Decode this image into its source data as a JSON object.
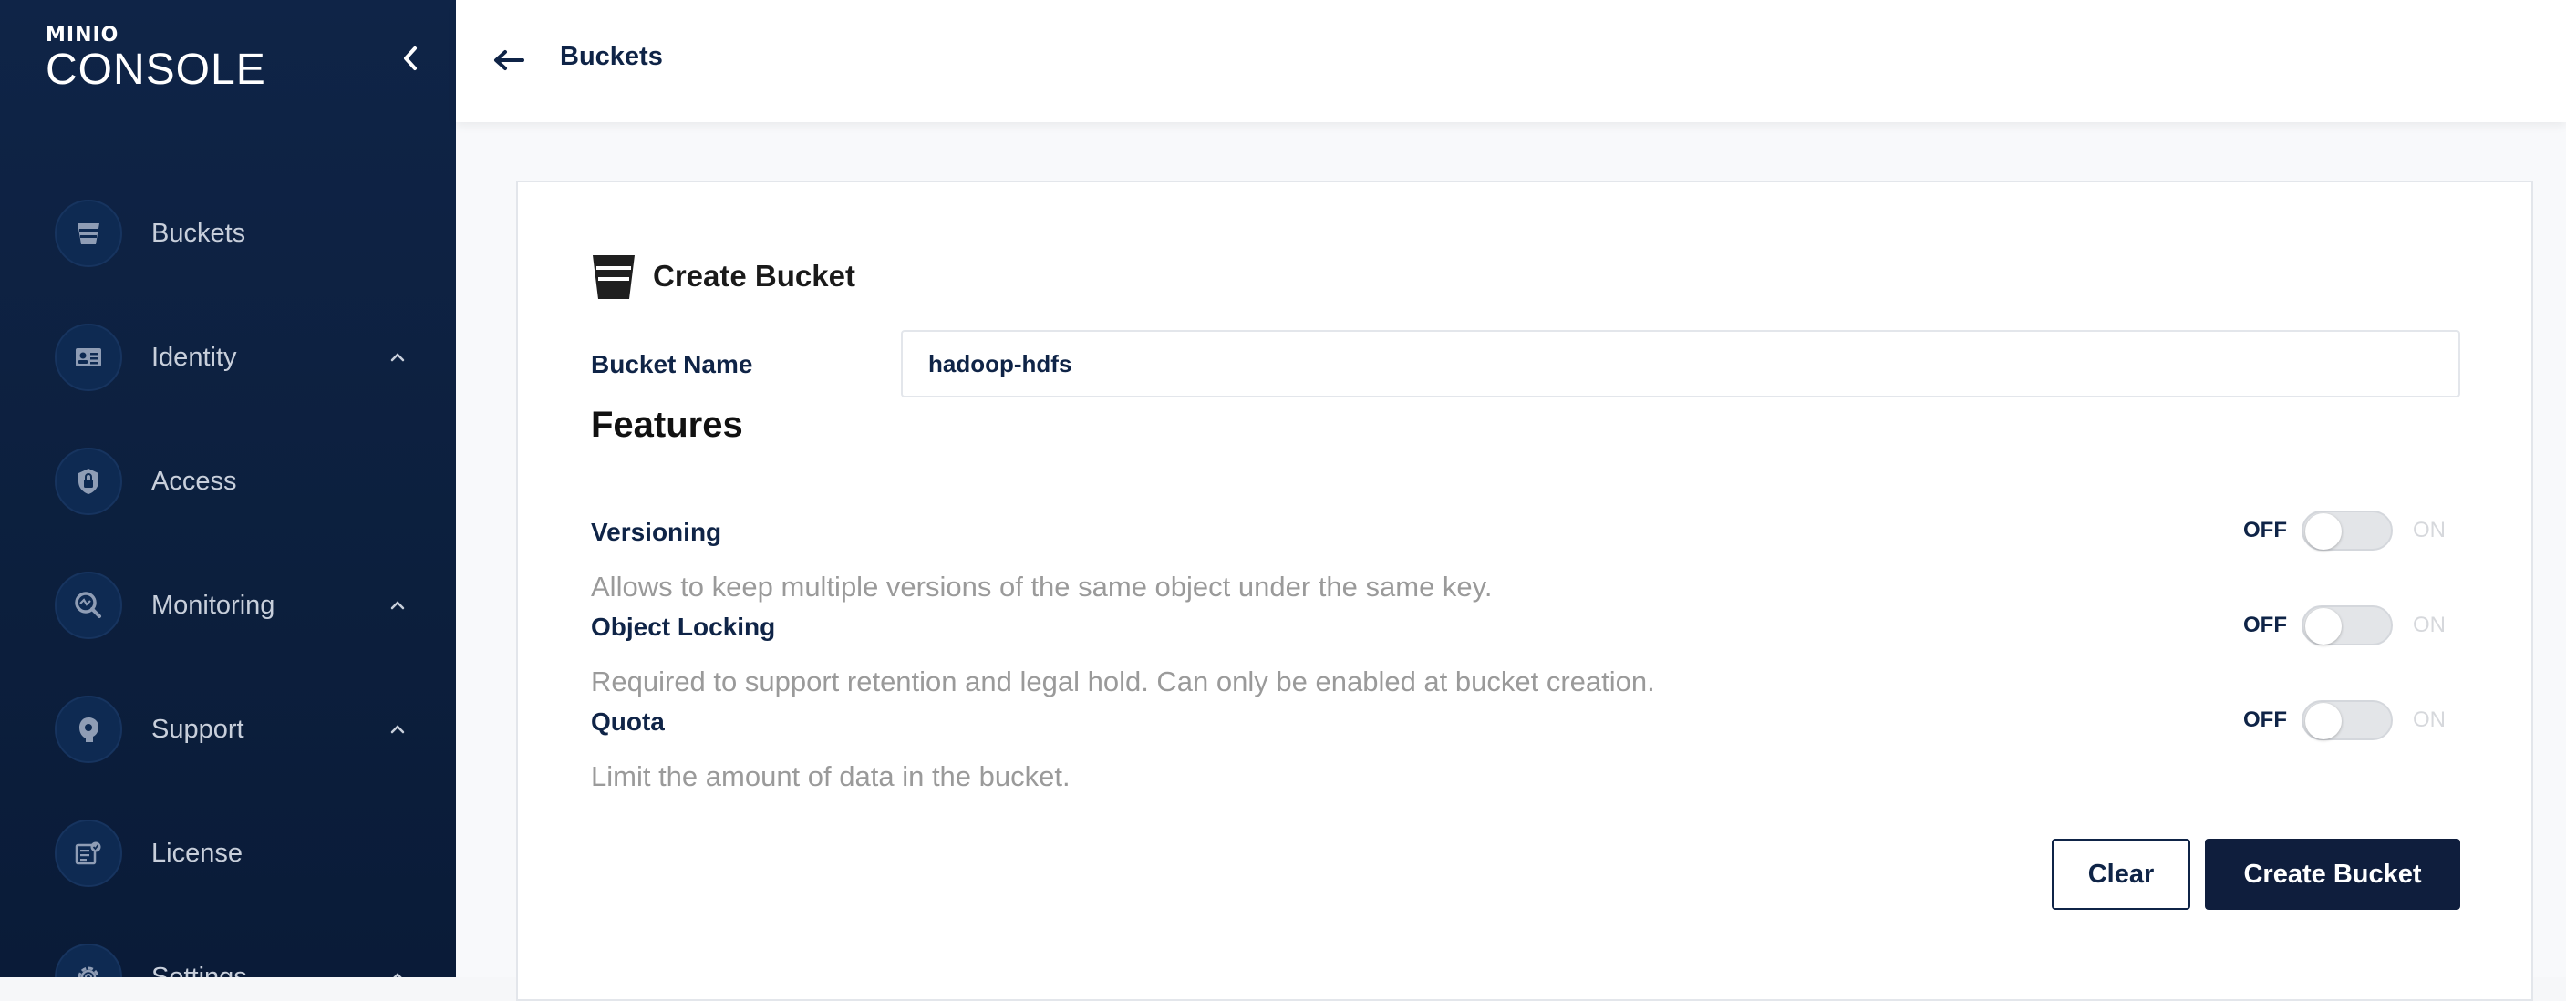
{
  "sidebar": {
    "logo_small": "MINIO",
    "logo_big": "CONSOLE",
    "items": [
      {
        "label": "Buckets",
        "icon": "bucket-icon",
        "has_chevron": false
      },
      {
        "label": "Identity",
        "icon": "id-card-icon",
        "has_chevron": true
      },
      {
        "label": "Access",
        "icon": "lock-shield-icon",
        "has_chevron": false
      },
      {
        "label": "Monitoring",
        "icon": "monitoring-icon",
        "has_chevron": true
      },
      {
        "label": "Support",
        "icon": "support-icon",
        "has_chevron": true
      },
      {
        "label": "License",
        "icon": "license-icon",
        "has_chevron": false
      },
      {
        "label": "Settings",
        "icon": "gear-icon",
        "has_chevron": true
      }
    ]
  },
  "header": {
    "title": "Buckets"
  },
  "form": {
    "title": "Create Bucket",
    "bucket_name_label": "Bucket Name",
    "bucket_name_value": "hadoop-hdfs",
    "features_heading": "Features",
    "features": [
      {
        "title": "Versioning",
        "description": "Allows to keep multiple versions of the same object under the same key.",
        "off_label": "OFF",
        "on_label": "ON",
        "state": "off"
      },
      {
        "title": "Object Locking",
        "description": "Required to support retention and legal hold. Can only be enabled at bucket creation.",
        "off_label": "OFF",
        "on_label": "ON",
        "state": "off"
      },
      {
        "title": "Quota",
        "description": "Limit the amount of data in the bucket.",
        "off_label": "OFF",
        "on_label": "ON",
        "state": "off"
      }
    ],
    "clear_label": "Clear",
    "create_label": "Create Bucket"
  },
  "colors": {
    "sidebar_bg": "#0f2447",
    "primary": "#0f1e3d",
    "muted_text": "#9a9a9a"
  }
}
